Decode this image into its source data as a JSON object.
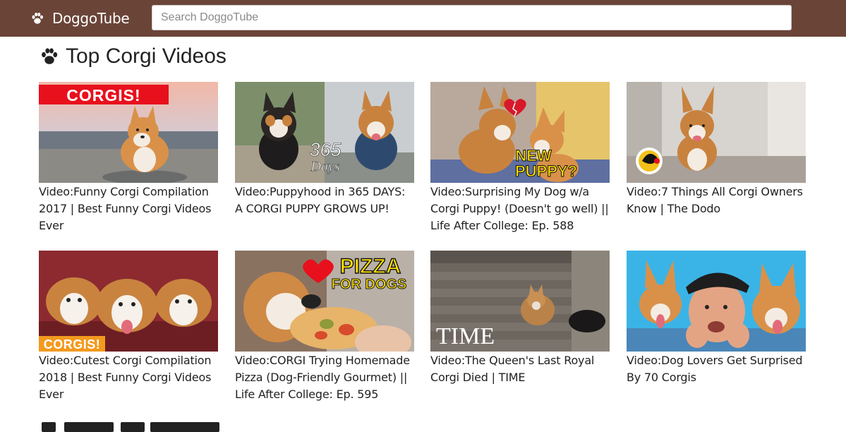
{
  "app": {
    "name": "DoggoTube"
  },
  "search": {
    "placeholder": "Search DoggoTube",
    "value": ""
  },
  "section": {
    "title": "Top Corgi Videos"
  },
  "videos": [
    {
      "caption": "Video:Funny Corgi Compilation 2017 | Best Funny Corgi Videos Ever",
      "overlay": "CORGIS!"
    },
    {
      "caption": "Video:Puppyhood in 365 DAYS: A CORGI PUPPY GROWS UP!",
      "overlay_num": "365",
      "overlay_word": "Days"
    },
    {
      "caption": "Video:Surprising My Dog w/a Corgi Puppy! (Doesn't go well) || Life After College: Ep. 588",
      "overlay_line1": "NEW",
      "overlay_line2": "PUPPY?"
    },
    {
      "caption": "Video:7 Things All Corgi Owners Know | The Dodo"
    },
    {
      "caption": "Video:Cutest Corgi Compilation 2018 | Best Funny Corgi Videos Ever",
      "overlay": "CORGIS!"
    },
    {
      "caption": "Video:CORGI Trying Homemade Pizza (Dog-Friendly Gourmet) || Life After College: Ep. 595",
      "overlay_line1": "PIZZA",
      "overlay_line2": "FOR DOGS"
    },
    {
      "caption": "Video:The Queen's Last Royal Corgi Died | TIME",
      "overlay": "TIME"
    },
    {
      "caption": "Video:Dog Lovers Get Surprised By 70 Corgis"
    }
  ],
  "colors": {
    "topbar": "#6b4438",
    "corgi_orange": "#d9914a",
    "banner_red": "#e8101d",
    "banner_orange": "#f39a1e",
    "pizza_yellow": "#ffe100"
  }
}
